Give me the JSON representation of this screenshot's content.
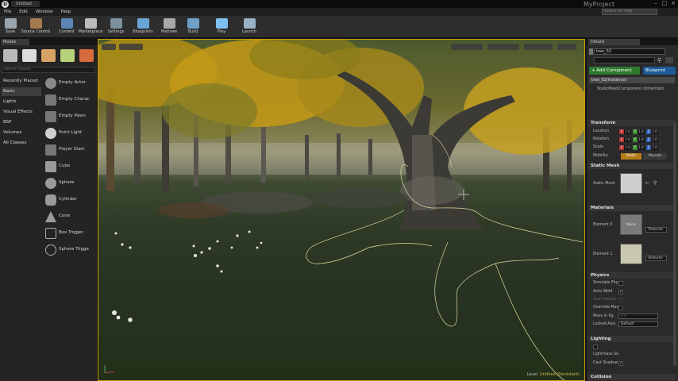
{
  "window": {
    "level_tab": "Untitled",
    "project_name": "MyProject",
    "controls": {
      "minimize": "–",
      "maximize": "□",
      "close": "×"
    }
  },
  "menu": [
    "File",
    "Edit",
    "Window",
    "Help"
  ],
  "search_help": {
    "placeholder": "Search For Help"
  },
  "toolbar": [
    {
      "label": "Save",
      "color": "#9aa4ad"
    },
    {
      "label": "Source Control",
      "color": "#a67a4f"
    },
    {
      "label": "Content",
      "color": "#5d86b4"
    },
    {
      "label": "Marketplace",
      "color": "#bcbcbc"
    },
    {
      "label": "Settings",
      "color": "#7c8f9c"
    },
    {
      "label": "Blueprints",
      "color": "#6aa3d6"
    },
    {
      "label": "Matinee",
      "color": "#a8a8a8"
    },
    {
      "label": "Build",
      "color": "#6fa0c8"
    },
    {
      "label": "Play",
      "color": "#7ec0f2"
    },
    {
      "label": "Launch",
      "color": "#9ab0c4"
    }
  ],
  "modes": {
    "tab": "Modes",
    "search_placeholder": "Search Classes",
    "tools": [
      {
        "icon": "place-mode-icon",
        "color": "#b9b9b9"
      },
      {
        "icon": "paint-mode-icon",
        "color": "#dddddd"
      },
      {
        "icon": "landscape-mode-icon",
        "color": "#d6a266"
      },
      {
        "icon": "foliage-mode-icon",
        "color": "#b6d27a"
      },
      {
        "icon": "geometry-mode-icon",
        "color": "#d66b3e"
      }
    ],
    "categories": [
      "Recently Placed",
      "Basic",
      "Lights",
      "Visual Effects",
      "BSP",
      "Volumes",
      "All Classes"
    ],
    "selected_category": "Basic",
    "items": [
      "Empty Actor",
      "Empty Charac",
      "Empty Pawn",
      "Point Light",
      "Player Start",
      "Cube",
      "Sphere",
      "Cylinder",
      "Cone",
      "Box Trigger",
      "Sphere Trigge"
    ]
  },
  "viewport": {
    "level_label": "Level:",
    "level_name": "Untitled (Persistent)"
  },
  "details": {
    "tab": "Details",
    "actor_name": "tree_02",
    "add_component": "+ Add Component",
    "blueprint_button": "Blueprint",
    "instance_label": "tree_02(Instance)",
    "component_label": "StaticMeshComponent (Inherited)",
    "transform": {
      "title": "Transform",
      "location_label": "Location",
      "rotation_label": "Rotation",
      "scale_label": "Scale",
      "mobility_label": "Mobility",
      "location": [
        "1.0",
        "1.0",
        "1.0"
      ],
      "rotation": [
        "1.0",
        "1.0",
        "1.0"
      ],
      "scale": [
        "1.0",
        "1.0",
        "1.0"
      ],
      "mobility_static": "Static",
      "mobility_movable": "Movabl"
    },
    "static_mesh": {
      "title": "Static Mesh",
      "label": "Static Mesh"
    },
    "materials": {
      "title": "Materials",
      "element0": "Element 0",
      "element1": "Element 1",
      "none_label": "None",
      "textures0": "Textures",
      "textures1": "Textures"
    },
    "physics": {
      "title": "Physics",
      "simulate": "Simulate Phy",
      "auto_weld": "Auto Weld",
      "start_awake": "Start Awake",
      "override_mass": "Override Mas",
      "mass": "Mass in Kg",
      "locked_axis": "Locked Axis",
      "locked_value": "Default",
      "mass_value": "0.0"
    },
    "lighting": {
      "title": "Lighting",
      "lightmass": "Lightmass Se",
      "cast_shadow": "Cast Shadow"
    },
    "collision": {
      "title": "Collision"
    }
  }
}
